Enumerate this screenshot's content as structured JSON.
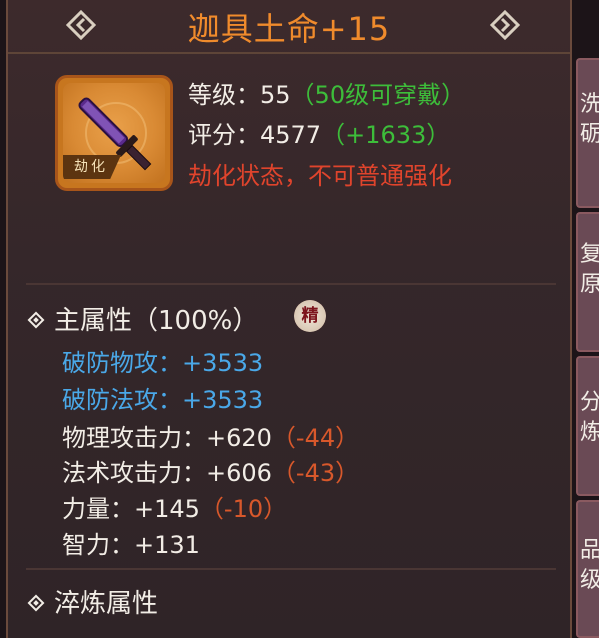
{
  "item": {
    "name": "迦具土命+15",
    "tag": "劫化",
    "level_label": "等级：",
    "level_value": "55",
    "level_note": "（50级可穿戴）",
    "score_label": "评分：",
    "score_value": "4577",
    "score_delta": "（+1633）",
    "status": "劫化状态，不可普通强化"
  },
  "main_attr": {
    "heading": "主属性（100%）",
    "badge": "精",
    "rows": [
      {
        "label": "破防物攻：",
        "value": "+3533",
        "delta": ""
      },
      {
        "label": "破防法攻：",
        "value": "+3533",
        "delta": ""
      },
      {
        "label": "物理攻击力：",
        "value": "+620",
        "delta": "（-44）"
      },
      {
        "label": "法术攻击力：",
        "value": "+606",
        "delta": "（-43）"
      },
      {
        "label": "力量：",
        "value": "+145",
        "delta": "（-10）"
      },
      {
        "label": "智力：",
        "value": "+131",
        "delta": ""
      }
    ]
  },
  "refine_attr": {
    "heading": "淬炼属性"
  },
  "side_tabs": [
    {
      "t1": "洗",
      "t2": "砺"
    },
    {
      "t1": "复",
      "t2": "原"
    },
    {
      "t1": "分",
      "t2": "炼"
    },
    {
      "t1": "品",
      "t2": "级"
    }
  ],
  "colors": {
    "title": "#f08b2c",
    "green": "#3dbd3a",
    "red": "#e0442c",
    "blue": "#4aa8e8"
  }
}
